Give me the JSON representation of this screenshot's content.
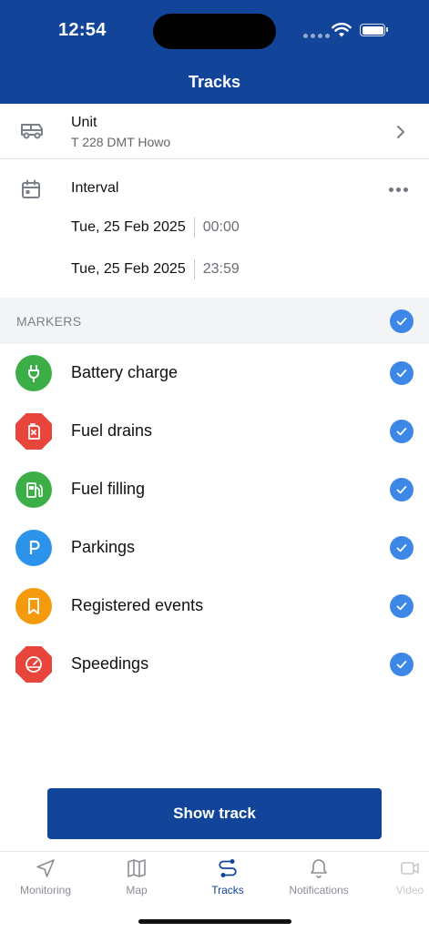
{
  "status_bar": {
    "time": "12:54"
  },
  "header": {
    "title": "Tracks"
  },
  "unit": {
    "label": "Unit",
    "value": "T 228 DMT Howo"
  },
  "interval": {
    "label": "Interval",
    "from": {
      "date": "Tue, 25 Feb 2025",
      "time": "00:00"
    },
    "to": {
      "date": "Tue, 25 Feb 2025",
      "time": "23:59"
    }
  },
  "markers": {
    "title": "MARKERS",
    "all_checked": true,
    "items": [
      {
        "label": "Battery charge",
        "icon": "plug-icon",
        "color": "#3cae48",
        "checked": true
      },
      {
        "label": "Fuel drains",
        "icon": "fuel-drain-icon",
        "color": "#e8453c",
        "checked": true
      },
      {
        "label": "Fuel filling",
        "icon": "fuel-pump-icon",
        "color": "#3cae48",
        "checked": true
      },
      {
        "label": "Parkings",
        "icon": "parking-icon",
        "color": "#2b93ea",
        "checked": true
      },
      {
        "label": "Registered events",
        "icon": "bookmark-icon",
        "color": "#f59a0c",
        "checked": true
      },
      {
        "label": "Speedings",
        "icon": "speedometer-icon",
        "color": "#e8453c",
        "checked": true
      }
    ]
  },
  "actions": {
    "show_track": "Show track"
  },
  "tabs": [
    {
      "label": "Monitoring",
      "icon": "navigation-arrow-icon",
      "active": false
    },
    {
      "label": "Map",
      "icon": "map-icon",
      "active": false
    },
    {
      "label": "Tracks",
      "icon": "route-icon",
      "active": true
    },
    {
      "label": "Notifications",
      "icon": "bell-icon",
      "active": false
    },
    {
      "label": "Video",
      "icon": "video-icon",
      "active": false
    }
  ],
  "colors": {
    "brand": "#12459a",
    "check": "#3d87e8"
  }
}
